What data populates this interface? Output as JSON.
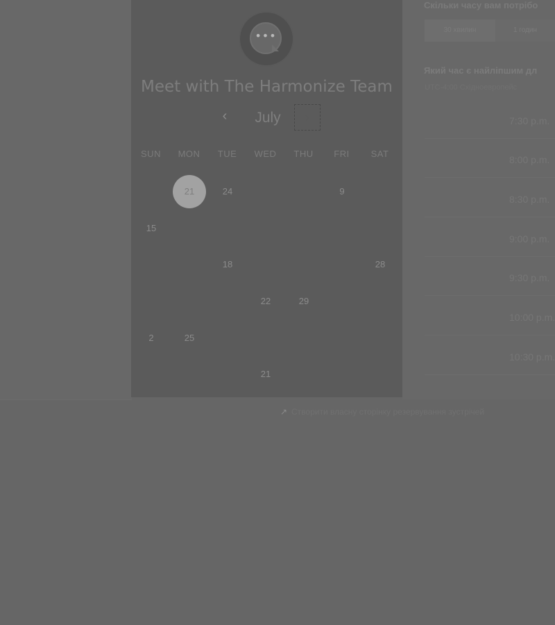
{
  "card": {
    "title": "Meet with The Harmonize Team",
    "month": "July",
    "prev_icon": "chevron-left-icon",
    "next_icon": "chevron-right-icon"
  },
  "calendar": {
    "weekdays": [
      "SUN",
      "MON",
      "TUE",
      "WED",
      "THU",
      "FRI",
      "SAT"
    ],
    "rows": [
      [
        "",
        "21",
        "24",
        "",
        "",
        "9",
        ""
      ],
      [
        "15",
        "",
        "",
        "",
        "",
        "",
        ""
      ],
      [
        "",
        "",
        "18",
        "",
        "",
        "",
        "28"
      ],
      [
        "",
        "",
        "",
        "22",
        "29",
        "",
        ""
      ],
      [
        "2",
        "25",
        "",
        "",
        "",
        "",
        ""
      ],
      [
        "",
        "",
        "",
        "21",
        "",
        "",
        ""
      ]
    ],
    "selected_day": "21"
  },
  "right_panel": {
    "duration_heading": "Скільки часу вам потрібо",
    "durations": [
      "30 хвилин",
      "1 годин"
    ],
    "best_time_heading": "Який час є найліпшим дл",
    "timezone": "UTC-4:00 Східноевропейс",
    "slots": [
      "7:30 p.m.",
      "8:00 p.m.",
      "8:30 p.m.",
      "9:00 p.m.",
      "9:30 p.m.",
      "10:00 p.m.",
      "10:30 p.m."
    ]
  },
  "footer": {
    "create_link": "Створити власну сторінку резервування зустрічей",
    "link_icon": "external-link-icon"
  }
}
